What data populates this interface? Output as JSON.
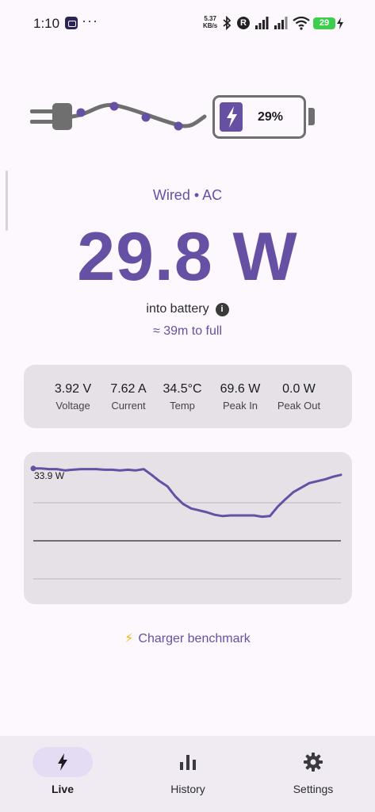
{
  "status_bar": {
    "time": "1:10",
    "dots": "···",
    "net_speed_value": "5.37",
    "net_speed_unit": "KB/s",
    "r_badge": "R",
    "battery_level": "29"
  },
  "battery_graphic": {
    "percent_label": "29%",
    "level": 0.29
  },
  "source_label": "Wired • AC",
  "power_value": "29.8 W",
  "into_label": "into battery",
  "info_glyph": "i",
  "eta": "≈ 39m to full",
  "stats": [
    {
      "value": "3.92 V",
      "label": "Voltage"
    },
    {
      "value": "7.62 A",
      "label": "Current"
    },
    {
      "value": "34.5°C",
      "label": "Temp"
    },
    {
      "value": "69.6 W",
      "label": "Peak In"
    },
    {
      "value": "0.0 W",
      "label": "Peak Out"
    }
  ],
  "chart_data": {
    "type": "line",
    "peak_label": "33.9 W",
    "x": [
      0,
      1,
      2,
      3,
      4,
      5,
      6,
      7,
      8,
      9,
      10,
      11,
      12,
      13,
      14,
      15,
      16,
      17,
      18,
      19,
      20,
      21,
      22,
      23,
      24,
      25,
      26,
      27,
      28,
      29,
      30,
      31,
      32,
      33,
      34,
      35,
      36,
      37,
      38,
      39
    ],
    "values": [
      33.9,
      33.9,
      33.8,
      33.8,
      33.6,
      33.7,
      33.8,
      33.8,
      33.8,
      33.7,
      33.7,
      33.6,
      33.7,
      33.6,
      33.8,
      32.9,
      31.9,
      31.1,
      29.5,
      28.3,
      27.6,
      27.3,
      27.0,
      26.6,
      26.4,
      26.5,
      26.5,
      26.5,
      26.5,
      26.3,
      26.4,
      27.9,
      29.1,
      30.2,
      30.9,
      31.6,
      31.9,
      32.2,
      32.6,
      32.9
    ],
    "ylim": [
      12.5,
      36.5
    ],
    "gridlines": [
      16.5,
      22.5,
      28.5
    ],
    "line_color": "#6650a4"
  },
  "benchmark": {
    "bolt": "⚡",
    "label": "Charger benchmark"
  },
  "nav": [
    {
      "label": "Live",
      "icon": "bolt-icon",
      "active": true
    },
    {
      "label": "History",
      "icon": "bar-chart-icon",
      "active": false
    },
    {
      "label": "Settings",
      "icon": "gear-icon",
      "active": false
    }
  ],
  "colors": {
    "accent": "#6650a4",
    "surface": "#fdf8fd",
    "card": "#e6e1e6",
    "nav_bg": "#f0ebf2"
  }
}
